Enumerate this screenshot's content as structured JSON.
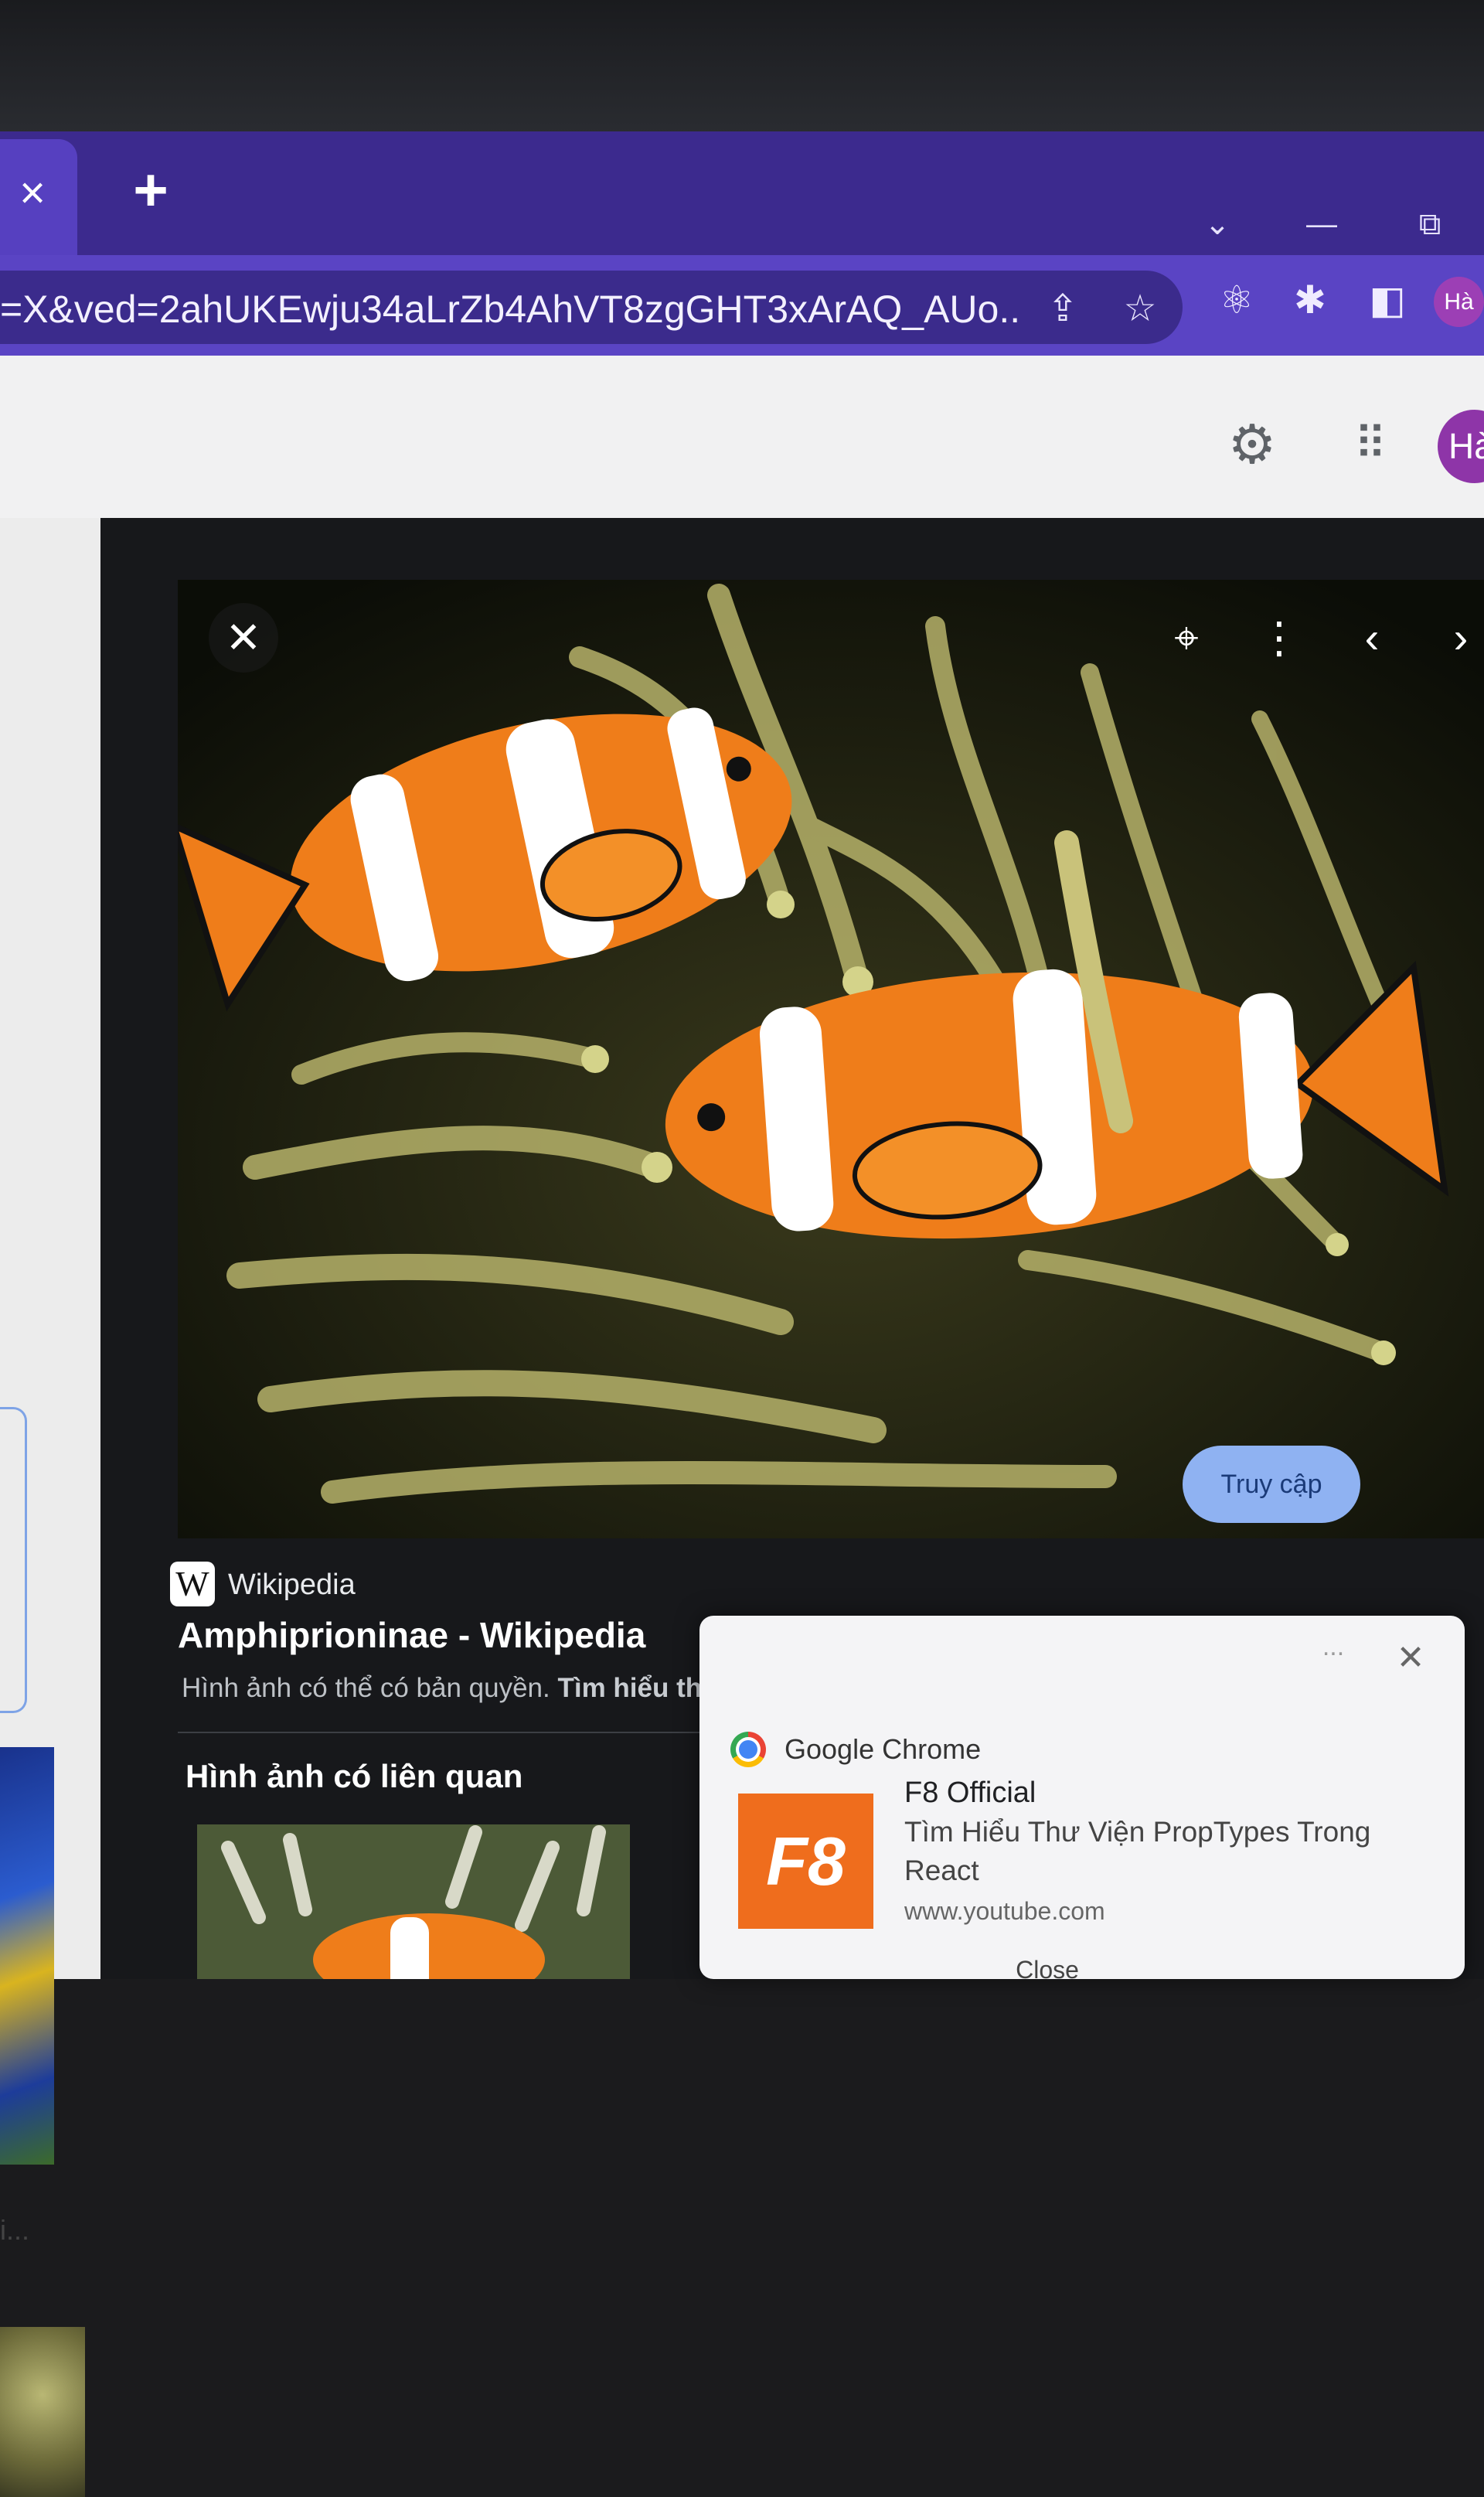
{
  "browser": {
    "tab_close": "×",
    "new_tab": "+",
    "controls": {
      "tab_search": "⌄",
      "minimize": "—",
      "restore": "⧉"
    },
    "url": "=X&ved=2ahUKEwju34aLrZb4AhVT8zgGHT3xArAQ_AUo...",
    "profile_initials": "Hà"
  },
  "page_header": {
    "profile_initials": "Hà"
  },
  "left_strip": {
    "truncated_label": "i..."
  },
  "preview": {
    "source_name": "Wikipedia",
    "wiki_logo_letter": "W",
    "title": "Amphiprioninae - Wikipedia",
    "copyright_text": "Hình ảnh có thể có bản quyền.",
    "learn_more": "Tìm hiểu thêm",
    "visit_button": "Truy cập",
    "related_heading": "Hình ảnh có liên quan"
  },
  "notification": {
    "app_name": "Google Chrome",
    "logo_text": "F8",
    "sender": "F8 Official",
    "message": "Tìm Hiểu Thư Viện PropTypes Trong React",
    "site": "www.youtube.com",
    "close_label": "Close",
    "more": "..."
  },
  "colors": {
    "tabstrip": "#3c2a8e",
    "toolbar": "#5a44c4",
    "omnibox": "#3b2b8c",
    "panel": "#17181b",
    "accent_button": "#8fb2f2",
    "f8_brand": "#ef6d1d"
  }
}
